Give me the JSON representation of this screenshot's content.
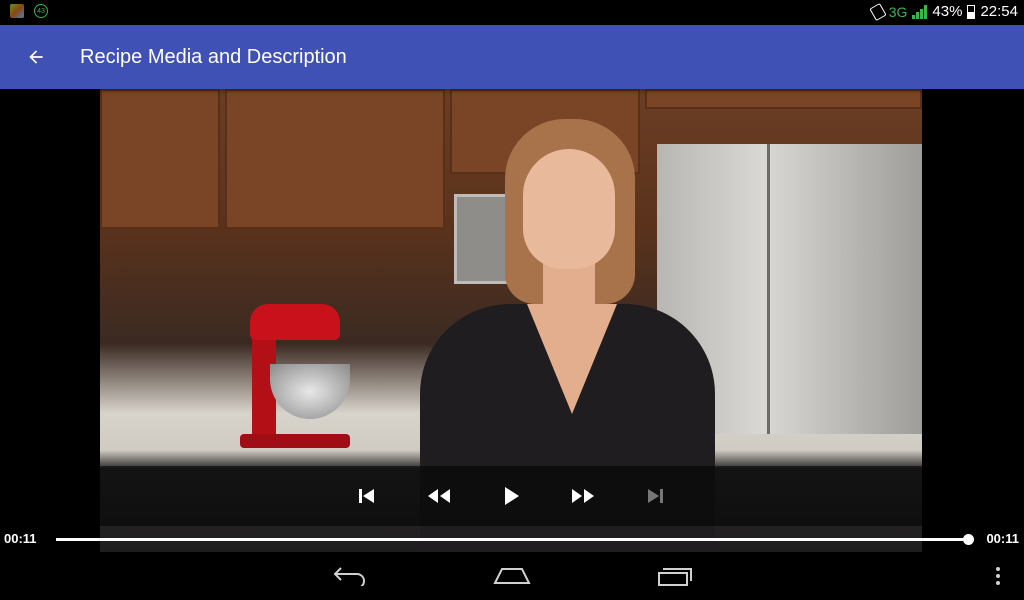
{
  "status_bar": {
    "network": "3G",
    "battery_percent": "43%",
    "battery_level": 0.43,
    "time": "22:54",
    "notification_count": "43",
    "icons": [
      "app-notification-icon",
      "count-badge-icon",
      "rotation-lock-icon",
      "signal-icon",
      "battery-icon"
    ]
  },
  "app_bar": {
    "title": "Recipe Media and Description",
    "back_icon": "arrow-back-icon",
    "color": "#3f51b5"
  },
  "player": {
    "controls": {
      "previous_icon": "skip-previous-icon",
      "rewind_icon": "rewind-icon",
      "play_icon": "play-icon",
      "fast_forward_icon": "fast-forward-icon",
      "next_icon": "skip-next-icon"
    },
    "position": "00:11",
    "duration": "00:11",
    "progress": 1.0
  },
  "nav_bar": {
    "icons": [
      "back-icon",
      "home-icon",
      "recents-icon",
      "overflow-menu-icon"
    ]
  }
}
